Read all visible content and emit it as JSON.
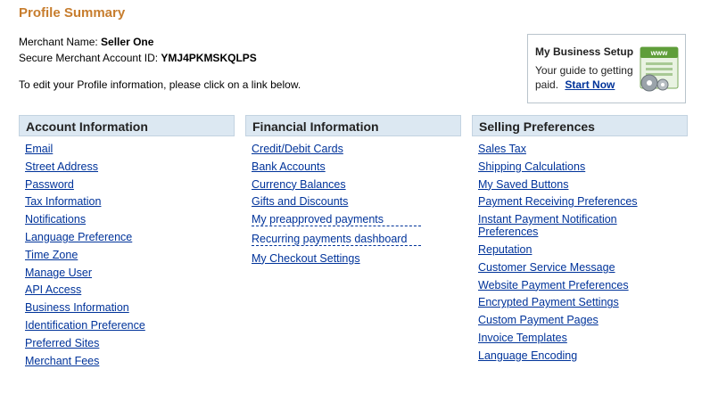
{
  "page_title": "Profile Summary",
  "merchant": {
    "name_label": "Merchant Name:",
    "name_value": "Seller One",
    "account_label": "Secure Merchant Account ID:",
    "account_value": "YMJ4PKMSKQLPS"
  },
  "edit_note": "To edit your Profile information, please click on a link below.",
  "setup_box": {
    "title": "My Business Setup",
    "desc": "Your guide to getting paid.",
    "link": "Start Now"
  },
  "account_info": {
    "header": "Account Information",
    "items": [
      "Email",
      "Street Address",
      "Password",
      "Tax Information",
      "Notifications",
      "Language Preference",
      "Time Zone",
      "Manage User",
      "API Access",
      "Business Information",
      "Identification Preference",
      "Preferred Sites",
      "Merchant Fees"
    ]
  },
  "financial_info": {
    "header": "Financial Information",
    "items": [
      "Credit/Debit Cards",
      "Bank Accounts",
      "Currency Balances",
      "Gifts and Discounts",
      "My preapproved payments",
      "Recurring payments dashboard",
      "My Checkout Settings"
    ]
  },
  "selling_prefs": {
    "header": "Selling Preferences",
    "items": [
      "Sales Tax",
      "Shipping Calculations",
      "My Saved Buttons",
      "Payment Receiving Preferences",
      "Instant Payment Notification Preferences",
      "Reputation",
      "Customer Service Message",
      "Website Payment Preferences",
      "Encrypted Payment Settings",
      "Custom Payment Pages",
      "Invoice Templates",
      "Language Encoding"
    ]
  },
  "colors": {
    "title": "#c77d2e",
    "link": "#00339a",
    "header_bg": "#dce8f2"
  }
}
